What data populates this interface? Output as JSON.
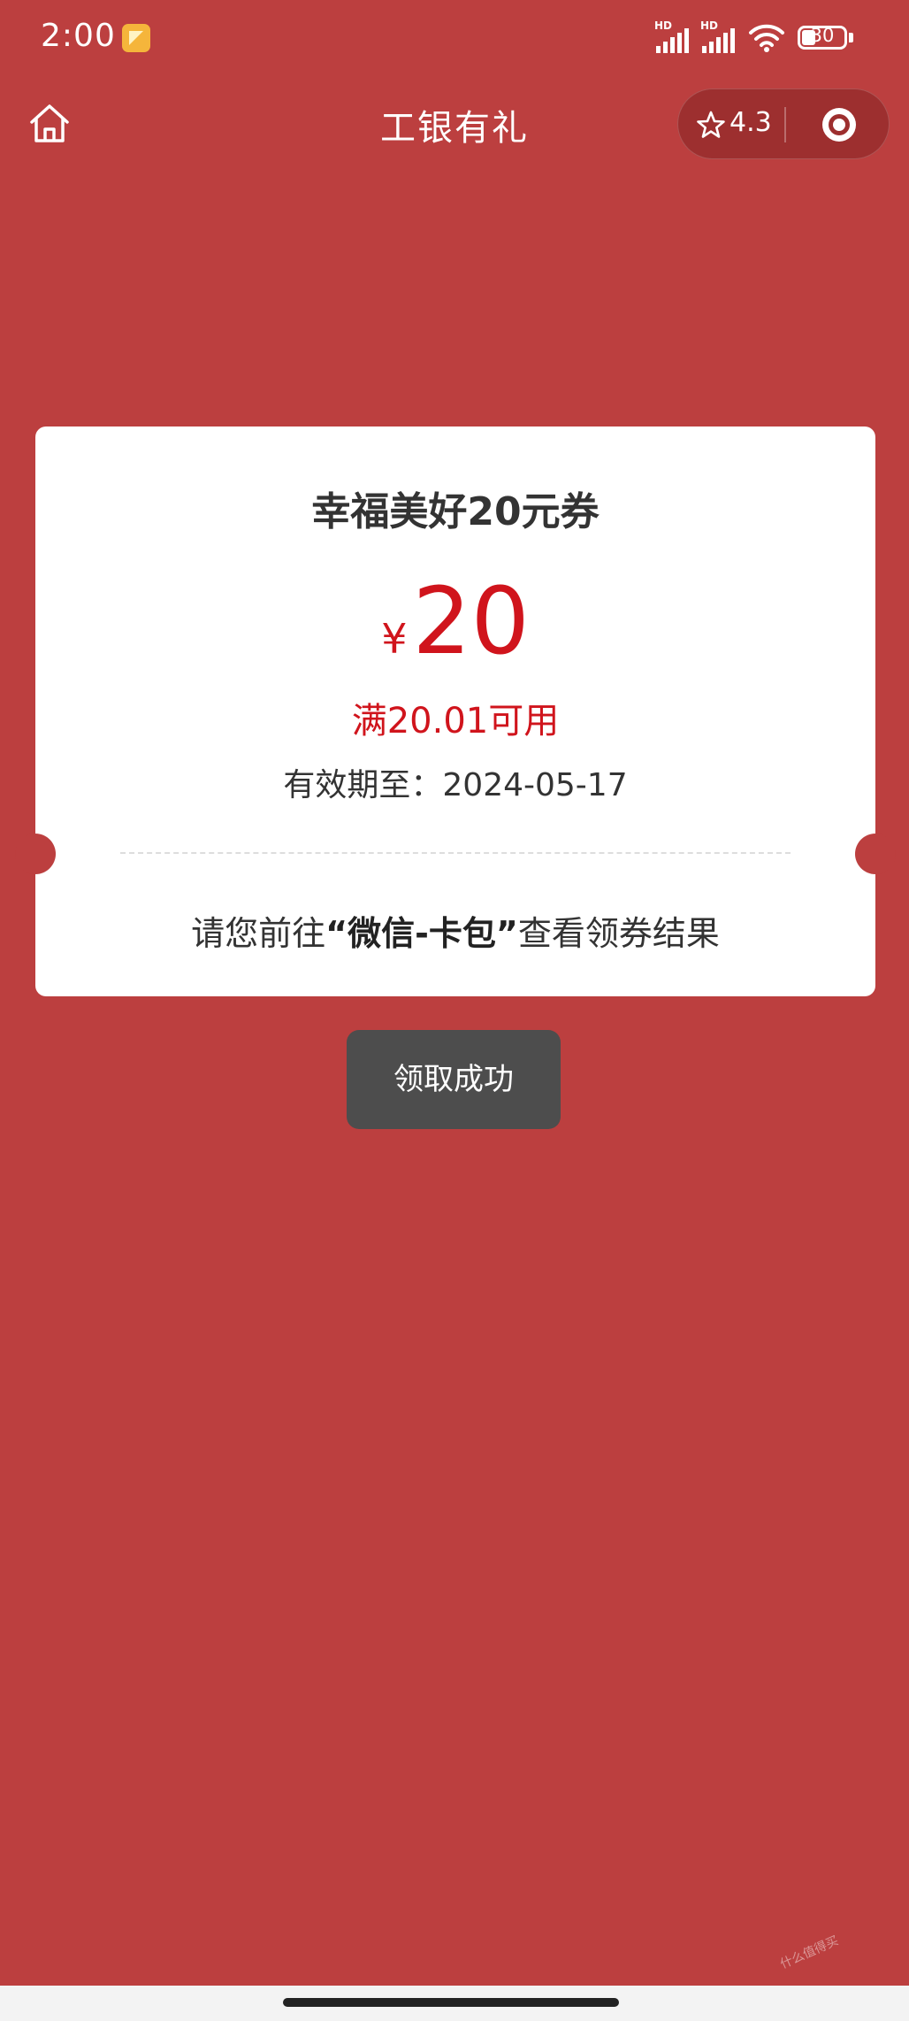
{
  "status_bar": {
    "time": "2:00",
    "signal1_label": "HD",
    "signal2_label": "HD",
    "battery": "30"
  },
  "nav": {
    "title": "工银有礼",
    "rating": "4.3"
  },
  "coupon": {
    "title": "幸福美好20元券",
    "currency": "¥",
    "amount": "20",
    "condition": "满20.01可用",
    "validity": "有效期至：2024-05-17",
    "tip_prefix": "请您前往",
    "tip_highlight": "“微信-卡包”",
    "tip_suffix": "查看领券结果"
  },
  "toast": {
    "message": "领取成功"
  },
  "watermark": "什么值得买",
  "colors": {
    "background": "#bc3f3f",
    "accent": "#d0141c",
    "toast": "#4d4d4d"
  },
  "icons": [
    "home-icon",
    "star-icon",
    "target-icon",
    "wifi-icon",
    "battery-icon"
  ]
}
